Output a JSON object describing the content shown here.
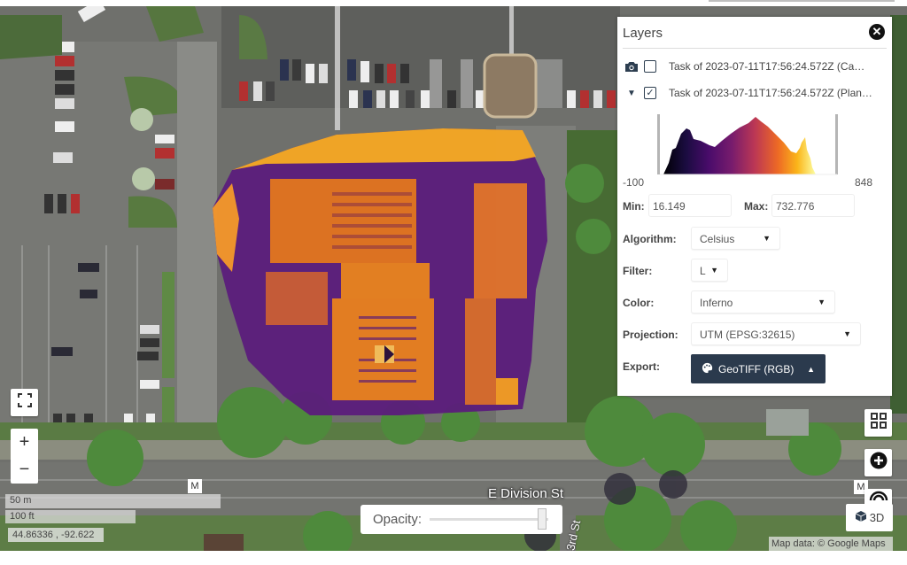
{
  "layers_panel": {
    "title": "Layers",
    "layers": [
      {
        "icon": "camera-icon",
        "checked": false,
        "label": "Task of 2023-07-11T17:56:24.572Z (Ca…"
      },
      {
        "icon": "caret-down-icon",
        "checked": true,
        "label": "Task of 2023-07-11T17:56:24.572Z (Plan…"
      }
    ],
    "histogram": {
      "range_min": "-100",
      "range_max": "848",
      "colormap": [
        "#000004",
        "#320a5e",
        "#781c6d",
        "#bc3754",
        "#ed6925",
        "#fbb61a",
        "#fcffa4"
      ]
    },
    "min_label": "Min:",
    "min_value": "16.149",
    "max_label": "Max:",
    "max_value": "732.776",
    "algorithm_label": "Algorithm:",
    "algorithm_value": "Celsius",
    "filter_label": "Filter:",
    "filter_value": "L",
    "color_label": "Color:",
    "color_value": "Inferno",
    "projection_label": "Projection:",
    "projection_value": "UTM (EPSG:32615)",
    "export_label": "Export:",
    "export_button": "GeoTIFF (RGB)"
  },
  "map": {
    "street_name": "E Division St",
    "street_name_2": "3rd St",
    "marker_label": "M",
    "scale_metric": "50 m",
    "scale_imperial": "100 ft",
    "coordinates": "44.86336 , -92.622",
    "attribution": "Map data: © Google Maps",
    "opacity_label": "Opacity:",
    "opacity_value": 0.95,
    "button_3d": "3D"
  },
  "colors": {
    "export_button_bg": "#2b3a4d",
    "thermal_hot": "#f7a51e",
    "thermal_mid": "#e06a1a",
    "thermal_cold": "#4b177a"
  }
}
